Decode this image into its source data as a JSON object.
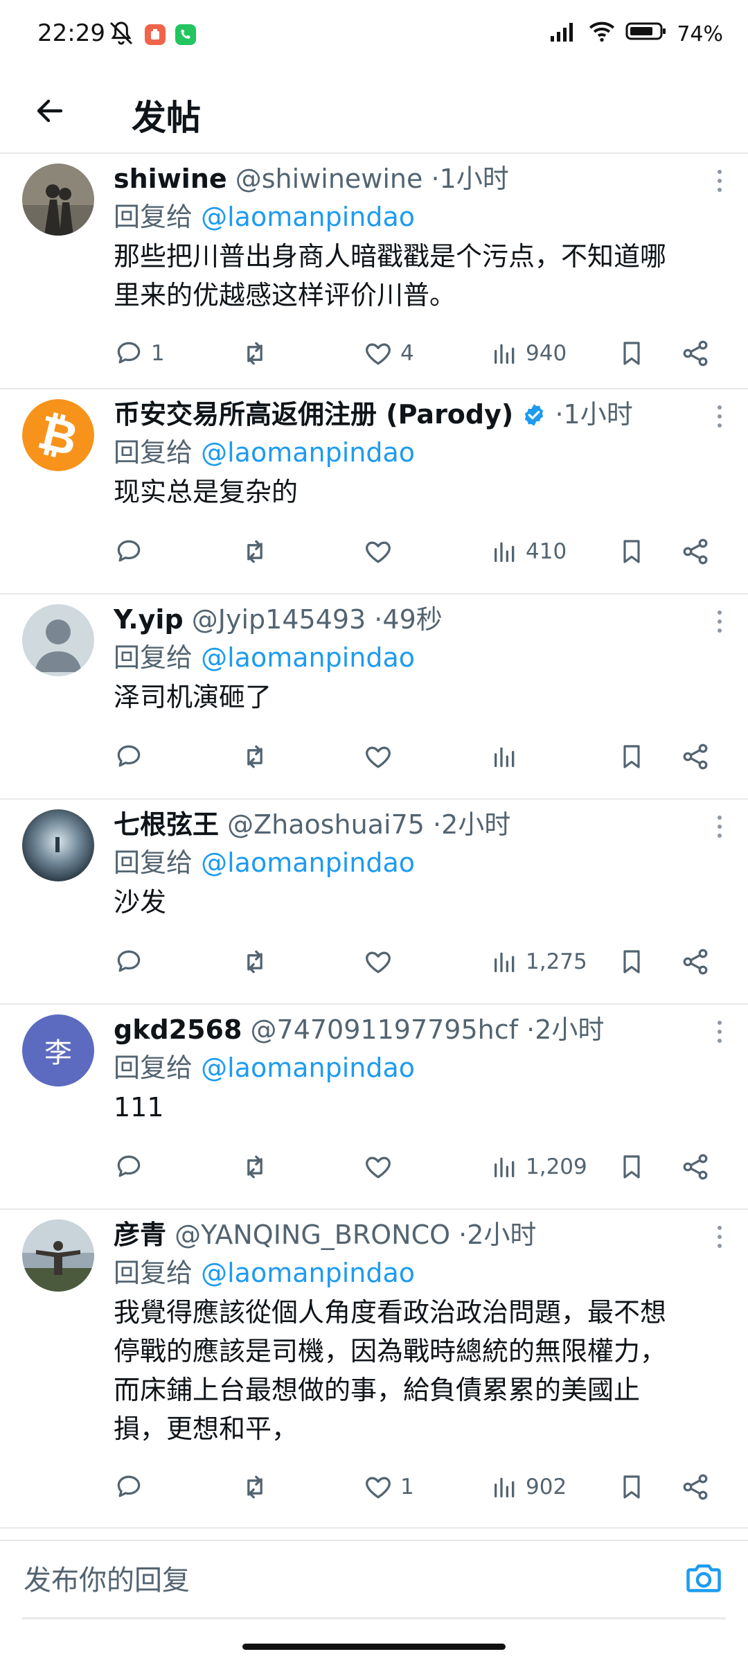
{
  "status_bar": {
    "time": "22:29",
    "battery": "74%"
  },
  "header": {
    "title": "发帖"
  },
  "reply_prefix": "回复给",
  "tweets": [
    {
      "name": "shiwine",
      "handle": "@shiwinewine",
      "dot": "·",
      "time": "1小时",
      "reply_to": "@laomanpindao",
      "text": [
        "那些把川普出身商人暗戳戳是个污点，不知道哪",
        "里来的优越感这样评价川普。"
      ],
      "replies": "1",
      "retweets": "",
      "likes": "4",
      "views": "940",
      "avatar": "photo-shadows",
      "verified": false
    },
    {
      "name": "币安交易所高返佣注册 (Parody)",
      "handle": "",
      "dot": "·",
      "time": "1小时",
      "reply_to": "@laomanpindao",
      "text": [
        "现实总是复杂的"
      ],
      "replies": "",
      "retweets": "",
      "likes": "",
      "views": "410",
      "avatar": "bitcoin-logo",
      "verified": true
    },
    {
      "name": "Y.yip",
      "handle": "@Jyip145493",
      "dot": "·",
      "time": "49秒",
      "reply_to": "@laomanpindao",
      "text": [
        "泽司机演砸了"
      ],
      "replies": "",
      "retweets": "",
      "likes": "",
      "views": "",
      "avatar": "default-user",
      "verified": false
    },
    {
      "name": "七根弦王",
      "handle": "@Zhaoshuai75",
      "dot": "·",
      "time": "2小时",
      "reply_to": "@laomanpindao",
      "text": [
        "沙发"
      ],
      "replies": "",
      "retweets": "",
      "likes": "",
      "views": "1,275",
      "avatar": "photo-sky",
      "verified": false
    },
    {
      "name": "gkd2568",
      "handle": "@747091197795hcf",
      "dot": "·",
      "time": "2小时",
      "reply_to": "@laomanpindao",
      "text": [
        "111"
      ],
      "replies": "",
      "retweets": "",
      "likes": "",
      "views": "1,209",
      "avatar": "letter-avatar",
      "avatar_letter": "李",
      "verified": false
    },
    {
      "name": "彦青",
      "handle": "@YANQING_BRONCO",
      "dot": "·",
      "time": "2小时",
      "reply_to": "@laomanpindao",
      "text": [
        "我覺得應該從個人角度看政治政治問題，最不想",
        "停戰的應該是司機，因為戰時總統的無限權力，",
        "而床鋪上台最想做的事，給負債累累的美國止",
        "損，更想和平，"
      ],
      "replies": "",
      "retweets": "",
      "likes": "1",
      "views": "902",
      "avatar": "photo-person",
      "verified": false
    }
  ],
  "composer": {
    "placeholder": "发布你的回复"
  },
  "colors": {
    "accent": "#1d9bf0",
    "text": "#0f1419",
    "secondary": "#536471",
    "divider": "#e7e9ea"
  }
}
